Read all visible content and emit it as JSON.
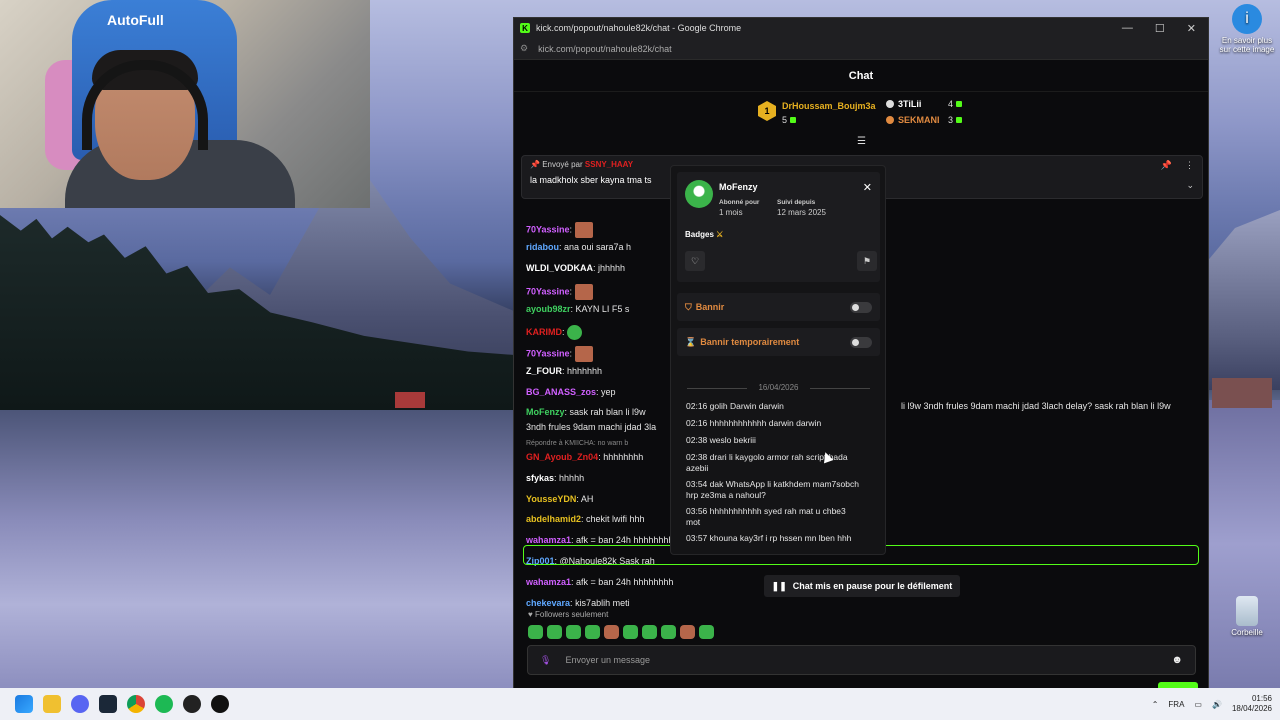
{
  "webcam": {
    "chair_brand": "AutoFull"
  },
  "desktop": {
    "icons": [
      {
        "label": "En savoir plus sur cette image",
        "name": "learn-more-image-icon"
      },
      {
        "label": "Corbeille",
        "name": "recycle-bin-icon"
      }
    ]
  },
  "browser": {
    "title": "kick.com/popout/nahoule82k/chat - Google Chrome",
    "url": "kick.com/popout/nahoule82k/chat",
    "minimize": "—",
    "maximize": "☐",
    "close": "✕"
  },
  "chat": {
    "header": "Chat",
    "leaderboard": [
      {
        "rank": "1",
        "name": "DrHoussam_Boujm3a",
        "count": "5"
      },
      {
        "name": "3TiLii",
        "count": "4"
      },
      {
        "name": "SEKMANI",
        "count": "3"
      }
    ],
    "pinned": {
      "sent_by_label": "Envoyé par",
      "sender": "SSNY_HAAY",
      "text": "la madkholx sber kayna tma ts"
    },
    "messages": [
      {
        "user": "70Yassine",
        "text": "",
        "color": "#d060ff"
      },
      {
        "user": "ridabou",
        "text": "ana oui sara7a h",
        "color": "#5fa8ff"
      },
      {
        "user": "WLDI_VODKAA",
        "text": "jhhhhh",
        "color": "#ffffff"
      },
      {
        "user": "70Yassine",
        "text": "",
        "color": "#d060ff"
      },
      {
        "user": "ayoub98zr",
        "text": "KAYN LI F5 s",
        "color": "#3fd060"
      },
      {
        "user": "KARIMD",
        "text": "",
        "color": "#e02020"
      },
      {
        "user": "70Yassine",
        "text": "",
        "color": "#d060ff"
      },
      {
        "user": "Z_FOUR",
        "text": "hhhhhhh",
        "color": "#ffffff"
      },
      {
        "user": "BG_ANASS_zos",
        "text": "yep",
        "color": "#d060ff"
      },
      {
        "user": "MoFenzy",
        "text": "sask rah blan li l9w",
        "color": "#3fd060"
      },
      {
        "user": "",
        "text": "3ndh frules 9dam machi jdad 3la",
        "color": "#ffffff"
      },
      {
        "user": "",
        "text": "Répondre à KMIICHA: no warn b",
        "color": "#888888"
      },
      {
        "user": "GN_Ayoub_Zn04",
        "text": "hhhhhhhh",
        "color": "#e02020"
      },
      {
        "user": "sfykas",
        "text": "hhhhh",
        "color": "#ffffff"
      },
      {
        "user": "YousseYDN",
        "text": "AH",
        "color": "#e6c020"
      },
      {
        "user": "abdelhamid2",
        "text": "chekit lwifi hhh",
        "color": "#e6c020"
      },
      {
        "user": "wahamza1",
        "text": "afk = ban 24h hhhhhhhh",
        "color": "#d060ff"
      },
      {
        "user": "Zip001",
        "text": "@Nahoule82k Sask rah",
        "color": "#5fa8ff"
      },
      {
        "user": "wahamza1",
        "text": "afk = ban 24h hhhhhhhh",
        "color": "#d060ff"
      },
      {
        "user": "chekevara",
        "text": "kis7ablih meti",
        "color": "#5fa8ff"
      }
    ],
    "overflow_text": "li l9w 3ndh frules 9dam machi jdad 3lach delay? sask rah blan li l9w",
    "paused_label": "Chat mis en pause pour le défilement",
    "followers_only": "Followers seulement",
    "input_placeholder": "Envoyer un message"
  },
  "popup": {
    "username": "MoFenzy",
    "subscribed_label": "Abonné pour",
    "subscribed_value": "1 mois",
    "followed_label": "Suivi depuis",
    "followed_value": "12 mars 2025",
    "badges_label": "Badges",
    "ban_label": "Bannir",
    "timeout_label": "Bannir temporairement",
    "history_date": "16/04/2026",
    "history": [
      {
        "time": "02:16",
        "text": "golih Darwin darwin"
      },
      {
        "time": "02:16",
        "text": "hhhhhhhhhhhh darwin darwin"
      },
      {
        "time": "02:38",
        "text": "weslo bekriii"
      },
      {
        "time": "02:38",
        "text": "drari li kaygolo armor rah script hada azebii"
      },
      {
        "time": "03:54",
        "text": "dak WhatsApp li katkhdem mam7sobch hrp ze3ma a nahoul?"
      },
      {
        "time": "03:56",
        "text": "hhhhhhhhhhh syed rah mat u chbe3 mot"
      },
      {
        "time": "03:57",
        "text": "khouna kay3rf i rp hssen mn lben hhh"
      }
    ]
  },
  "taskbar": {
    "language": "FRA",
    "time": "01:56",
    "date": "18/04/2026"
  }
}
